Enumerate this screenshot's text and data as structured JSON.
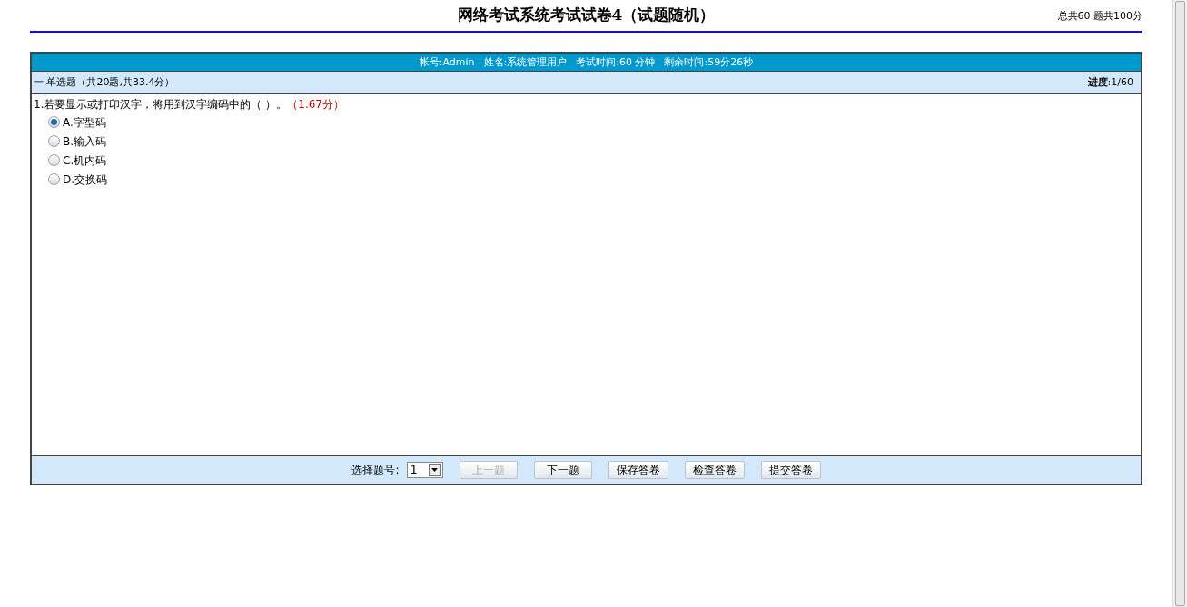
{
  "page_title": "网络考试系统考试试卷4（试题随机）",
  "summary": "总共60 题共100分",
  "info_bar": [
    "帐号:Admin",
    "姓名:系统管理用户",
    "考试时间:60 分钟",
    "剩余时间:59分26秒"
  ],
  "section": {
    "title": "一.单选题（共20题,共33.4分）",
    "progress": "**进度**:1/60"
  },
  "question": {
    "text": "1.若要显示或打印汉字，将用到汉字编码中的（ ）。",
    "score": "（1.67分）",
    "options": [
      {
        "label": "A.字型码",
        "selected": true
      },
      {
        "label": "B.输入码",
        "selected": false
      },
      {
        "label": "C.机内码",
        "selected": false
      },
      {
        "label": "D.交换码",
        "selected": false
      }
    ]
  },
  "footer": {
    "select_label": "选择题号:",
    "select_value": "1",
    "buttons": [
      {
        "label": "上一题",
        "disabled": true
      },
      {
        "label": "下一题",
        "disabled": false
      },
      {
        "label": "保存答卷",
        "disabled": false
      },
      {
        "label": "检查答卷",
        "disabled": false
      },
      {
        "label": "提交答卷",
        "disabled": false
      }
    ]
  }
}
